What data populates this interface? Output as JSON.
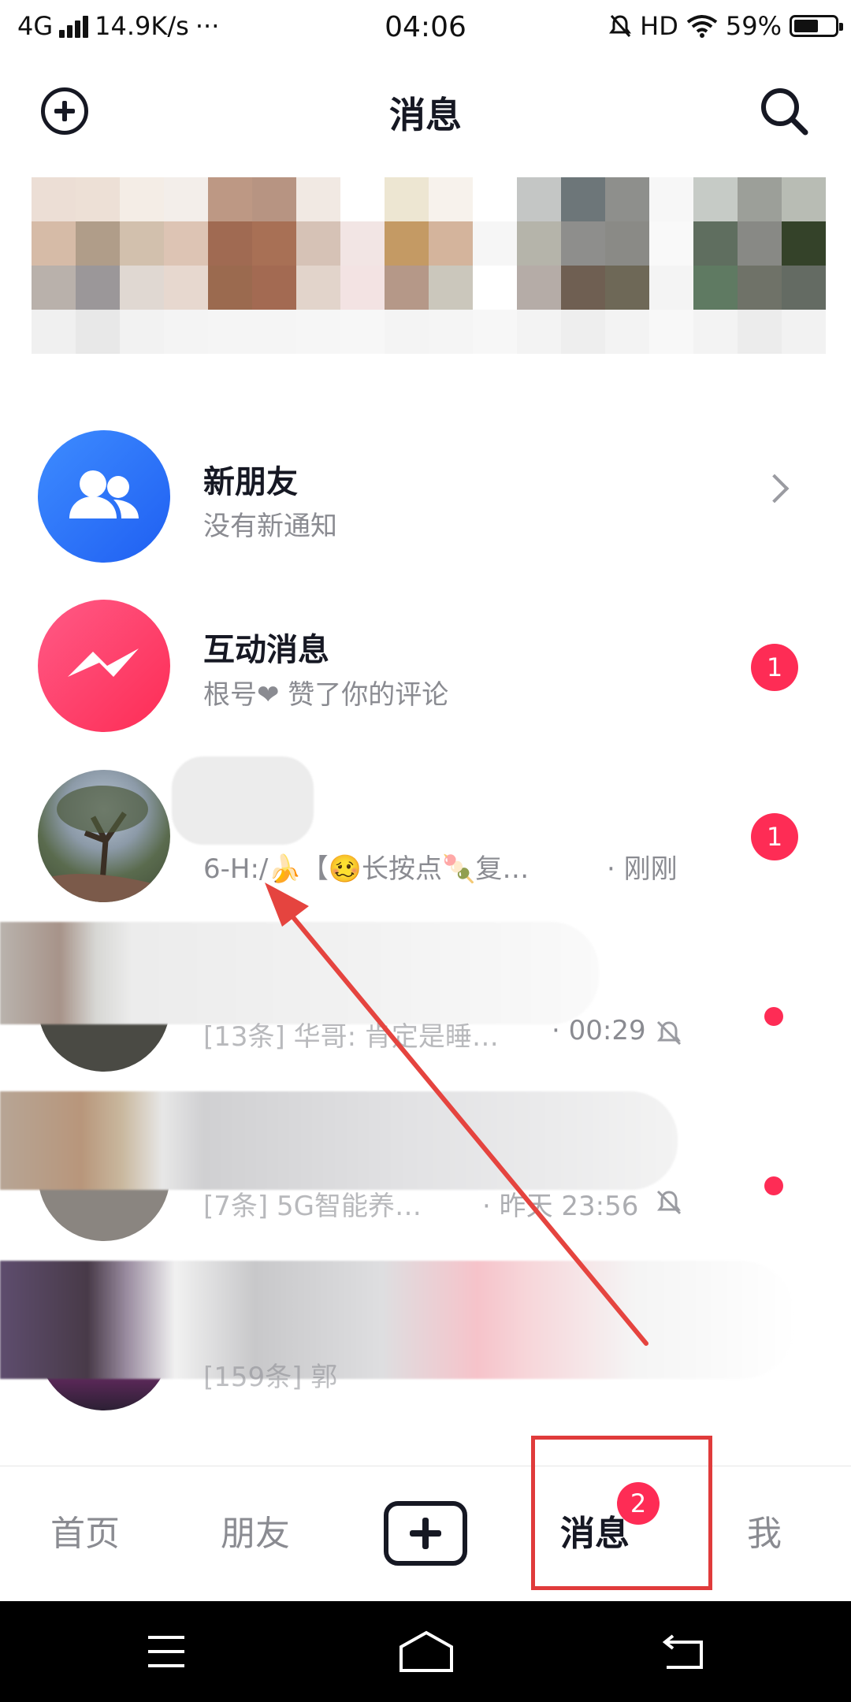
{
  "status_bar": {
    "network": "4G",
    "speed": "14.9K/s",
    "more": "···",
    "time": "04:06",
    "hd": "HD",
    "battery": "59%",
    "battery_level": 0.59
  },
  "header": {
    "title": "消息",
    "add_icon": "add-circle-icon",
    "search_icon": "search-icon"
  },
  "rows": [
    {
      "title": "新朋友",
      "subtitle": "没有新通知",
      "avatar_color": "#2a6cf6",
      "icon": "friends-icon"
    },
    {
      "title": "互动消息",
      "subtitle": "根号❤ 赞了你的评论",
      "avatar_color": "#fe2c55",
      "icon": "messenger-bolt-icon",
      "badge": "1"
    },
    {
      "subtitle": "6-H:/🍌【🥴长按点🍡复…",
      "time": "· 刚刚",
      "badge": "1"
    },
    {
      "subtitle": "[13条] 华哥: 肯定是睡…",
      "time": "· 00:29",
      "muted": true
    },
    {
      "subtitle": "[7条] 5G智能养…",
      "time": "· 昨天 23:56",
      "muted": true
    },
    {
      "subtitle": "[159条] 郭",
      "muted": true
    }
  ],
  "bottom_nav": {
    "items": [
      "首页",
      "朋友",
      "消息",
      "我"
    ],
    "active": "消息",
    "badge": "2"
  },
  "colors": {
    "accent": "#fe2c55",
    "blue": "#2a6cf6",
    "annotation_red": "#e03b3b"
  }
}
